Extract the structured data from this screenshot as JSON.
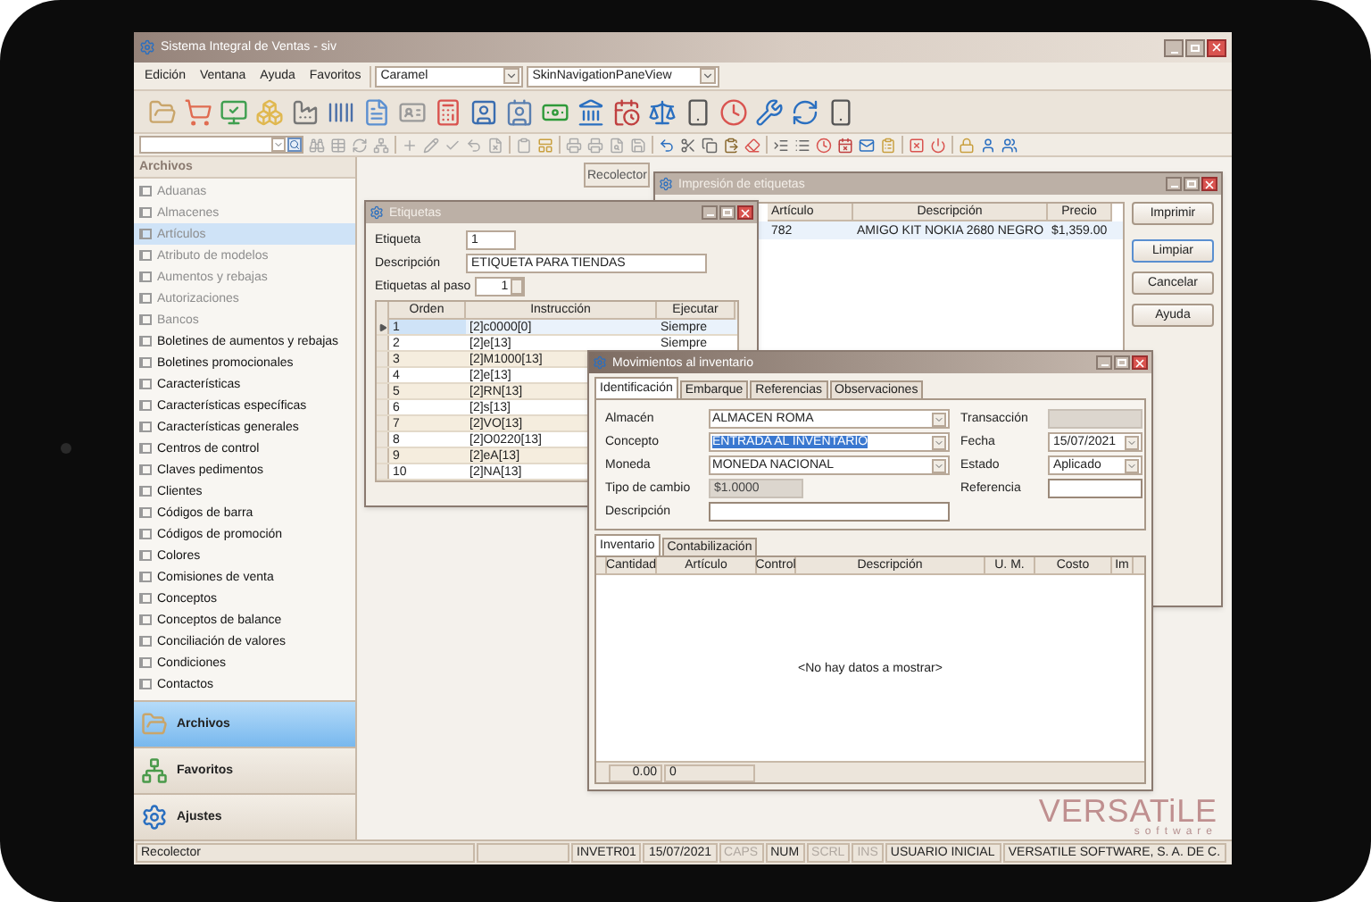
{
  "window": {
    "title": "Sistema Integral de Ventas - siv"
  },
  "menu": [
    "Edición",
    "Ventana",
    "Ayuda",
    "Favoritos"
  ],
  "skin_combo": {
    "value": "Caramel"
  },
  "view_combo": {
    "value": "SkinNavigationPaneView"
  },
  "sidebar": {
    "header": "Archivos",
    "items": [
      {
        "label": "Aduanas",
        "disabled": true,
        "selected": false
      },
      {
        "label": "Almacenes",
        "disabled": true,
        "selected": false
      },
      {
        "label": "Artículos",
        "disabled": true,
        "selected": true
      },
      {
        "label": "Atributo de modelos",
        "disabled": true,
        "selected": false
      },
      {
        "label": "Aumentos y rebajas",
        "disabled": true,
        "selected": false
      },
      {
        "label": "Autorizaciones",
        "disabled": true,
        "selected": false
      },
      {
        "label": "Bancos",
        "disabled": true,
        "selected": false
      },
      {
        "label": "Boletines de aumentos y rebajas",
        "disabled": false,
        "selected": false
      },
      {
        "label": "Boletines promocionales",
        "disabled": false,
        "selected": false
      },
      {
        "label": "Características",
        "disabled": false,
        "selected": false
      },
      {
        "label": "Características específicas",
        "disabled": false,
        "selected": false
      },
      {
        "label": "Características generales",
        "disabled": false,
        "selected": false
      },
      {
        "label": "Centros de control",
        "disabled": false,
        "selected": false
      },
      {
        "label": "Claves pedimentos",
        "disabled": false,
        "selected": false
      },
      {
        "label": "Clientes",
        "disabled": false,
        "selected": false
      },
      {
        "label": "Códigos de barra",
        "disabled": false,
        "selected": false
      },
      {
        "label": "Códigos de promoción",
        "disabled": false,
        "selected": false
      },
      {
        "label": "Colores",
        "disabled": false,
        "selected": false
      },
      {
        "label": "Comisiones de venta",
        "disabled": false,
        "selected": false
      },
      {
        "label": "Conceptos",
        "disabled": false,
        "selected": false
      },
      {
        "label": "Conceptos de balance",
        "disabled": false,
        "selected": false
      },
      {
        "label": "Conciliación de valores",
        "disabled": false,
        "selected": false
      },
      {
        "label": "Condiciones",
        "disabled": false,
        "selected": false
      },
      {
        "label": "Contactos",
        "disabled": false,
        "selected": false
      }
    ],
    "nav": [
      {
        "label": "Archivos",
        "kind": "folder",
        "selected": true
      },
      {
        "label": "Favoritos",
        "kind": "tree",
        "selected": false
      },
      {
        "label": "Ajustes",
        "kind": "gears",
        "selected": false
      }
    ]
  },
  "workspace_tab": "Recolector",
  "etiquetas_window": {
    "title": "Etiquetas",
    "fields": [
      {
        "label": "Etiqueta",
        "value": "1",
        "kind": "short"
      },
      {
        "label": "Descripción",
        "value": "ETIQUETA PARA TIENDAS",
        "kind": "long"
      },
      {
        "label": "Etiquetas al paso",
        "value": "1",
        "kind": "spin"
      }
    ],
    "columns": [
      "Orden",
      "Instrucción",
      "Ejecutar"
    ],
    "rows": [
      {
        "orden": "1",
        "instruccion": "[2]c0000[0]",
        "ejecutar": "Siempre",
        "selected": true
      },
      {
        "orden": "2",
        "instruccion": "[2]e[13]",
        "ejecutar": "Siempre",
        "selected": false
      },
      {
        "orden": "3",
        "instruccion": "[2]M1000[13]",
        "selected": false
      },
      {
        "orden": "4",
        "instruccion": "[2]e[13]",
        "selected": false
      },
      {
        "orden": "5",
        "instruccion": "[2]RN[13]",
        "selected": false
      },
      {
        "orden": "6",
        "instruccion": "[2]s[13]",
        "selected": false
      },
      {
        "orden": "7",
        "instruccion": "[2]VO[13]",
        "selected": false
      },
      {
        "orden": "8",
        "instruccion": "[2]O0220[13]",
        "selected": false
      },
      {
        "orden": "9",
        "instruccion": "[2]eA[13]",
        "selected": false
      },
      {
        "orden": "10",
        "instruccion": "[2]NA[13]",
        "selected": false
      }
    ]
  },
  "impresion_window": {
    "title": "Impresión de etiquetas",
    "columns": [
      "Artículo",
      "Descripción",
      "Precio"
    ],
    "rows": [
      {
        "articulo": "782",
        "descripcion": "AMIGO KIT NOKIA 2680 NEGRO",
        "precio": "$1,359.00"
      }
    ],
    "buttons": [
      {
        "label": "Imprimir",
        "default": false
      },
      {
        "label": "Limpiar",
        "default": true
      },
      {
        "label": "Cancelar",
        "default": false
      },
      {
        "label": "Ayuda",
        "default": false
      }
    ]
  },
  "movimientos_window": {
    "title": "Movimientos al inventario",
    "tabs": [
      {
        "label": "Identificación",
        "selected": true
      },
      {
        "label": "Embarque",
        "selected": false
      },
      {
        "label": "Referencias",
        "selected": false
      },
      {
        "label": "Observaciones",
        "selected": false
      }
    ],
    "left_fields": [
      {
        "label": "Almacén",
        "kind": "combo",
        "value": "ALMACEN ROMA",
        "highlighted": false
      },
      {
        "label": "Concepto",
        "kind": "combo",
        "value": "ENTRADA AL INVENTARIO",
        "highlighted": true
      },
      {
        "label": "Moneda",
        "kind": "combo",
        "value": "MONEDA NACIONAL",
        "highlighted": false
      },
      {
        "label": "Tipo de cambio",
        "kind": "short",
        "value": "$1.0000",
        "disabled": true
      },
      {
        "label": "Descripción",
        "kind": "text",
        "disabled": false
      }
    ],
    "right_fields": [
      {
        "label": "Transacción",
        "kind": "text",
        "disabled": true
      },
      {
        "label": "Fecha",
        "kind": "combo",
        "value": "15/07/2021"
      },
      {
        "label": "Estado",
        "kind": "combo",
        "value": "Aplicado"
      },
      {
        "label": "Referencia",
        "kind": "text",
        "disabled": false
      }
    ],
    "sub_tabs": [
      {
        "label": "Inventario",
        "selected": true
      },
      {
        "label": "Contabilización",
        "selected": false
      }
    ],
    "columns": [
      "Cantidad",
      "Artículo",
      "Control",
      "Descripción",
      "U. M.",
      "Costo",
      "Im"
    ],
    "empty_text": "<No hay datos a mostrar>",
    "footer": [
      "0.00",
      "0"
    ]
  },
  "logo": {
    "name": "VERSATiLE",
    "tagline": "software"
  },
  "status_bar": [
    {
      "text": "Recolector",
      "disabled": false
    },
    {
      "text": "INVETR01",
      "disabled": false
    },
    {
      "text": "15/07/2021",
      "disabled": false
    },
    {
      "text": "CAPS",
      "disabled": true
    },
    {
      "text": "NUM",
      "disabled": false
    },
    {
      "text": "SCRL",
      "disabled": true
    },
    {
      "text": "INS",
      "disabled": true
    },
    {
      "text": "USUARIO INICIAL",
      "disabled": false
    },
    {
      "text": "VERSATILE SOFTWARE, S. A. DE C.",
      "disabled": false
    }
  ]
}
